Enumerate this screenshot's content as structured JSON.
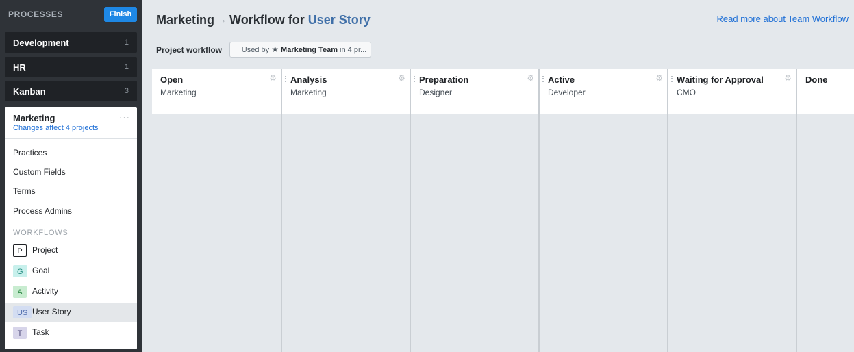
{
  "sidebar": {
    "title": "PROCESSES",
    "finish_label": "Finish",
    "processes": [
      {
        "name": "Development",
        "count": "1"
      },
      {
        "name": "HR",
        "count": "1"
      },
      {
        "name": "Kanban",
        "count": "3"
      }
    ],
    "current": {
      "name": "Marketing",
      "more": "···",
      "subtitle": "Changes affect 4 projects"
    },
    "links": [
      "Practices",
      "Custom Fields",
      "Terms",
      "Process Admins"
    ],
    "workflows_header": "WORKFLOWS",
    "workflows": [
      {
        "badge": "P",
        "label": "Project",
        "badge_bg": "#ffffff",
        "badge_fg": "#1f2226",
        "badge_border": "#1f2226"
      },
      {
        "badge": "G",
        "label": "Goal",
        "badge_bg": "#c8f0ec",
        "badge_fg": "#2a8f84",
        "badge_border": "#c8f0ec"
      },
      {
        "badge": "A",
        "label": "Activity",
        "badge_bg": "#c8ecd0",
        "badge_fg": "#2f8a45",
        "badge_border": "#c8ecd0"
      },
      {
        "badge": "US",
        "label": "User Story",
        "badge_bg": "#d3ddf2",
        "badge_fg": "#5672b0",
        "badge_border": "#d3ddf2"
      },
      {
        "badge": "T",
        "label": "Task",
        "badge_bg": "#d7d5ea",
        "badge_fg": "#4d4a7a",
        "badge_border": "#d7d5ea"
      }
    ]
  },
  "header": {
    "process": "Marketing",
    "arrow": "→",
    "middle": "Workflow for",
    "entity": "User Story",
    "read_more": "Read more about Team Workflow"
  },
  "toolbar": {
    "label": "Project workflow",
    "used_by_prefix": "Used by",
    "team": "Marketing Team",
    "used_by_suffix": "in 4 pr..."
  },
  "columns": [
    {
      "title": "Open",
      "role": "Marketing"
    },
    {
      "title": "Analysis",
      "role": "Marketing"
    },
    {
      "title": "Preparation",
      "role": "Designer"
    },
    {
      "title": "Active",
      "role": "Developer"
    },
    {
      "title": "Waiting for Approval",
      "role": "CMO"
    },
    {
      "title": "Done",
      "role": ""
    }
  ],
  "colors": {
    "accent": "#1e88e5",
    "link": "#1e6fd6",
    "sidebar_bg": "#2f3338"
  }
}
